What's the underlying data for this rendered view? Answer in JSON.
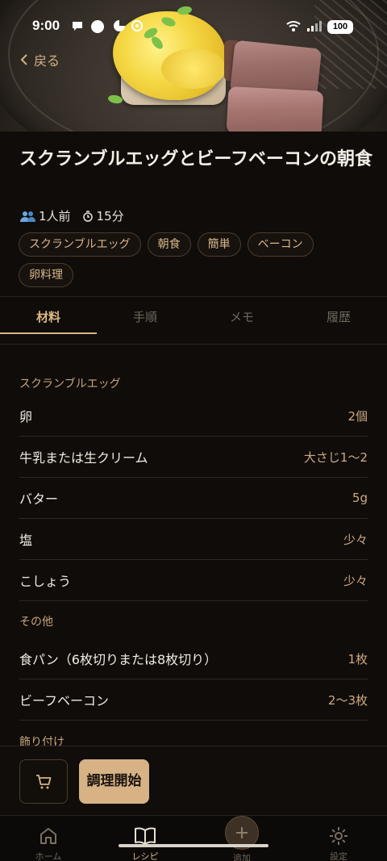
{
  "status_bar": {
    "time": "9:00",
    "battery": "100"
  },
  "header": {
    "back_label": "戻る"
  },
  "recipe": {
    "title": "スクランブルエッグとビーフベーコンの朝食",
    "servings": "1人前",
    "time": "15分",
    "tags": [
      "スクランブルエッグ",
      "朝食",
      "簡単",
      "ベーコン",
      "卵料理"
    ]
  },
  "tabs": [
    "材料",
    "手順",
    "メモ",
    "履歴"
  ],
  "active_tab": "材料",
  "ingredients": {
    "sections": [
      {
        "title": "スクランブルエッグ",
        "items": [
          {
            "name": "卵",
            "qty": "2個"
          },
          {
            "name": "牛乳または生クリーム",
            "qty": "大さじ1〜2"
          },
          {
            "name": "バター",
            "qty": "5g"
          },
          {
            "name": "塩",
            "qty": "少々"
          },
          {
            "name": "こしょう",
            "qty": "少々"
          }
        ]
      },
      {
        "title": "その他",
        "items": [
          {
            "name": "食パン（6枚切りまたは8枚切り）",
            "qty": "1枚"
          },
          {
            "name": "ビーフベーコン",
            "qty": "2〜3枚"
          }
        ]
      },
      {
        "title": "飾り付け",
        "items": []
      }
    ]
  },
  "actions": {
    "cook_label": "調理開始"
  },
  "nav": [
    {
      "label": "ホーム",
      "icon": "home-icon"
    },
    {
      "label": "レシピ",
      "icon": "book-icon"
    },
    {
      "label": "追加",
      "icon": "plus-icon"
    },
    {
      "label": "設定",
      "icon": "gear-icon"
    }
  ],
  "colors": {
    "accent": "#d6b285",
    "background": "#0f0c09"
  }
}
